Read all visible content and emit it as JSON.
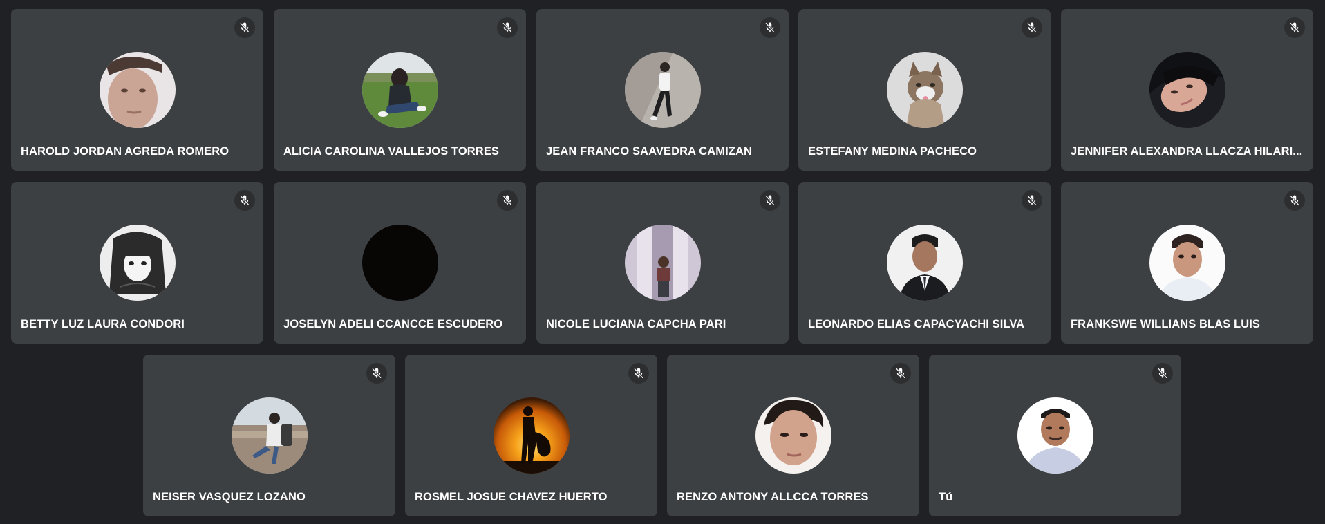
{
  "meeting": {
    "participants": [
      {
        "name": "HAROLD JORDAN AGREDA ROMERO",
        "muted": true,
        "avatar": "face-photo"
      },
      {
        "name": "ALICIA CAROLINA VALLEJOS TORRES",
        "muted": true,
        "avatar": "person-on-grass-photo"
      },
      {
        "name": "JEAN FRANCO SAAVEDRA CAMIZAN",
        "muted": true,
        "avatar": "person-leaning-wall-photo"
      },
      {
        "name": "ESTEFANY MEDINA PACHECO",
        "muted": true,
        "avatar": "cat-photo"
      },
      {
        "name": "JENNIFER ALEXANDRA LLACZA HILARI...",
        "muted": true,
        "avatar": "face-dark-hair-photo"
      },
      {
        "name": "BETTY LUZ LAURA CONDORI",
        "muted": true,
        "avatar": "anime-drawing"
      },
      {
        "name": "JOSELYN ADELI CCANCCE ESCUDERO",
        "muted": true,
        "avatar": "black-circle"
      },
      {
        "name": "NICOLE LUCIANA CAPCHA PARI",
        "muted": true,
        "avatar": "mirror-selfie-photo"
      },
      {
        "name": "LEONARDO ELIAS CAPACYACHI SILVA",
        "muted": true,
        "avatar": "suit-portrait-photo"
      },
      {
        "name": "FRANKSWE WILLIANS BLAS LUIS",
        "muted": true,
        "avatar": "portrait-white-bg-photo"
      },
      {
        "name": "NEISER VASQUEZ LOZANO",
        "muted": true,
        "avatar": "person-city-view-photo"
      },
      {
        "name": "ROSMEL JOSUE CHAVEZ HUERTO",
        "muted": true,
        "avatar": "guitar-silhouette-sunset"
      },
      {
        "name": "RENZO ANTONY ALLCCA TORRES",
        "muted": true,
        "avatar": "face-closeup-photo"
      },
      {
        "name": "Tú",
        "muted": true,
        "avatar": "portrait-man-photo"
      }
    ]
  },
  "colors": {
    "background": "#202124",
    "tile": "#3c4043",
    "mic_badge": "#2d2e30",
    "text": "#ffffff"
  },
  "icons": {
    "muted": "mic-off-icon"
  }
}
